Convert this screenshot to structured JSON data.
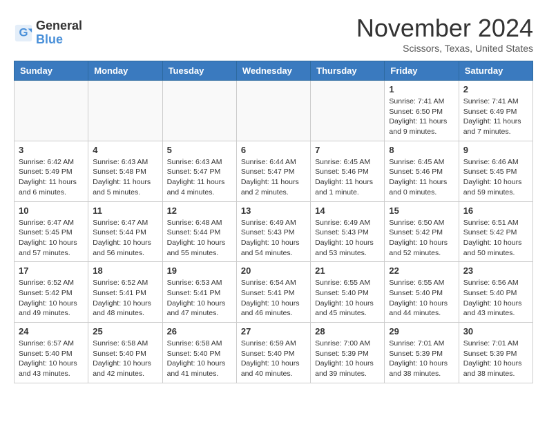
{
  "logo": {
    "general": "General",
    "blue": "Blue"
  },
  "header": {
    "month": "November 2024",
    "location": "Scissors, Texas, United States"
  },
  "weekdays": [
    "Sunday",
    "Monday",
    "Tuesday",
    "Wednesday",
    "Thursday",
    "Friday",
    "Saturday"
  ],
  "weeks": [
    [
      {
        "day": "",
        "info": ""
      },
      {
        "day": "",
        "info": ""
      },
      {
        "day": "",
        "info": ""
      },
      {
        "day": "",
        "info": ""
      },
      {
        "day": "",
        "info": ""
      },
      {
        "day": "1",
        "info": "Sunrise: 7:41 AM\nSunset: 6:50 PM\nDaylight: 11 hours and 9 minutes."
      },
      {
        "day": "2",
        "info": "Sunrise: 7:41 AM\nSunset: 6:49 PM\nDaylight: 11 hours and 7 minutes."
      }
    ],
    [
      {
        "day": "3",
        "info": "Sunrise: 6:42 AM\nSunset: 5:49 PM\nDaylight: 11 hours and 6 minutes."
      },
      {
        "day": "4",
        "info": "Sunrise: 6:43 AM\nSunset: 5:48 PM\nDaylight: 11 hours and 5 minutes."
      },
      {
        "day": "5",
        "info": "Sunrise: 6:43 AM\nSunset: 5:47 PM\nDaylight: 11 hours and 4 minutes."
      },
      {
        "day": "6",
        "info": "Sunrise: 6:44 AM\nSunset: 5:47 PM\nDaylight: 11 hours and 2 minutes."
      },
      {
        "day": "7",
        "info": "Sunrise: 6:45 AM\nSunset: 5:46 PM\nDaylight: 11 hours and 1 minute."
      },
      {
        "day": "8",
        "info": "Sunrise: 6:45 AM\nSunset: 5:46 PM\nDaylight: 11 hours and 0 minutes."
      },
      {
        "day": "9",
        "info": "Sunrise: 6:46 AM\nSunset: 5:45 PM\nDaylight: 10 hours and 59 minutes."
      }
    ],
    [
      {
        "day": "10",
        "info": "Sunrise: 6:47 AM\nSunset: 5:45 PM\nDaylight: 10 hours and 57 minutes."
      },
      {
        "day": "11",
        "info": "Sunrise: 6:47 AM\nSunset: 5:44 PM\nDaylight: 10 hours and 56 minutes."
      },
      {
        "day": "12",
        "info": "Sunrise: 6:48 AM\nSunset: 5:44 PM\nDaylight: 10 hours and 55 minutes."
      },
      {
        "day": "13",
        "info": "Sunrise: 6:49 AM\nSunset: 5:43 PM\nDaylight: 10 hours and 54 minutes."
      },
      {
        "day": "14",
        "info": "Sunrise: 6:49 AM\nSunset: 5:43 PM\nDaylight: 10 hours and 53 minutes."
      },
      {
        "day": "15",
        "info": "Sunrise: 6:50 AM\nSunset: 5:42 PM\nDaylight: 10 hours and 52 minutes."
      },
      {
        "day": "16",
        "info": "Sunrise: 6:51 AM\nSunset: 5:42 PM\nDaylight: 10 hours and 50 minutes."
      }
    ],
    [
      {
        "day": "17",
        "info": "Sunrise: 6:52 AM\nSunset: 5:42 PM\nDaylight: 10 hours and 49 minutes."
      },
      {
        "day": "18",
        "info": "Sunrise: 6:52 AM\nSunset: 5:41 PM\nDaylight: 10 hours and 48 minutes."
      },
      {
        "day": "19",
        "info": "Sunrise: 6:53 AM\nSunset: 5:41 PM\nDaylight: 10 hours and 47 minutes."
      },
      {
        "day": "20",
        "info": "Sunrise: 6:54 AM\nSunset: 5:41 PM\nDaylight: 10 hours and 46 minutes."
      },
      {
        "day": "21",
        "info": "Sunrise: 6:55 AM\nSunset: 5:40 PM\nDaylight: 10 hours and 45 minutes."
      },
      {
        "day": "22",
        "info": "Sunrise: 6:55 AM\nSunset: 5:40 PM\nDaylight: 10 hours and 44 minutes."
      },
      {
        "day": "23",
        "info": "Sunrise: 6:56 AM\nSunset: 5:40 PM\nDaylight: 10 hours and 43 minutes."
      }
    ],
    [
      {
        "day": "24",
        "info": "Sunrise: 6:57 AM\nSunset: 5:40 PM\nDaylight: 10 hours and 43 minutes."
      },
      {
        "day": "25",
        "info": "Sunrise: 6:58 AM\nSunset: 5:40 PM\nDaylight: 10 hours and 42 minutes."
      },
      {
        "day": "26",
        "info": "Sunrise: 6:58 AM\nSunset: 5:40 PM\nDaylight: 10 hours and 41 minutes."
      },
      {
        "day": "27",
        "info": "Sunrise: 6:59 AM\nSunset: 5:40 PM\nDaylight: 10 hours and 40 minutes."
      },
      {
        "day": "28",
        "info": "Sunrise: 7:00 AM\nSunset: 5:39 PM\nDaylight: 10 hours and 39 minutes."
      },
      {
        "day": "29",
        "info": "Sunrise: 7:01 AM\nSunset: 5:39 PM\nDaylight: 10 hours and 38 minutes."
      },
      {
        "day": "30",
        "info": "Sunrise: 7:01 AM\nSunset: 5:39 PM\nDaylight: 10 hours and 38 minutes."
      }
    ]
  ]
}
